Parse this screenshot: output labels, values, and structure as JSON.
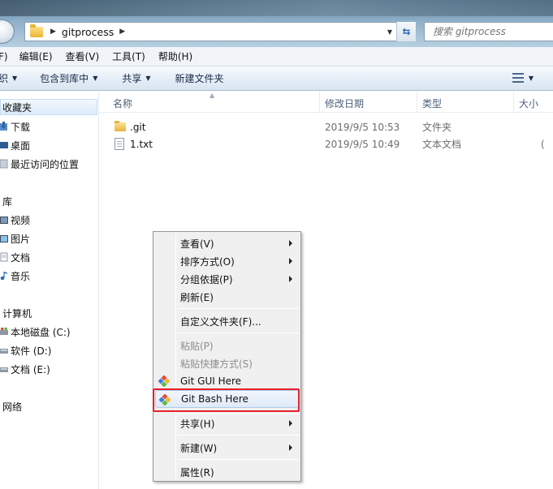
{
  "window": {
    "breadcrumb": [
      "gitprocess"
    ],
    "search_placeholder": "搜索 gitprocess"
  },
  "menubar": {
    "items": [
      "F)",
      "编辑(E)",
      "查看(V)",
      "工具(T)",
      "帮助(H)"
    ]
  },
  "commandbar": {
    "organize": "织",
    "include_in_library": "包含到库中",
    "share": "共享",
    "new_folder": "新建文件夹"
  },
  "navigation": {
    "favorites": {
      "label": "收藏夹",
      "items": [
        "下载",
        "桌面",
        "最近访问的位置"
      ]
    },
    "libraries": {
      "label": "库",
      "items": [
        "视频",
        "图片",
        "文档",
        "音乐"
      ]
    },
    "computer": {
      "label": "计算机",
      "items": [
        "本地磁盘 (C:)",
        "软件 (D:)",
        "文档 (E:)"
      ]
    },
    "network": {
      "label": "网络"
    }
  },
  "filelist": {
    "columns": {
      "name": "名称",
      "date": "修改日期",
      "type": "类型",
      "size": "大小"
    },
    "rows": [
      {
        "name": ".git",
        "date": "2019/9/5 10:53",
        "type": "文件夹",
        "size": "",
        "icon": "folder-icon"
      },
      {
        "name": "1.txt",
        "date": "2019/9/5 10:49",
        "type": "文本文档",
        "size": "(",
        "icon": "text-file-icon"
      }
    ]
  },
  "context_menu": {
    "items": [
      {
        "label": "查看(V)",
        "submenu": true,
        "disabled": false
      },
      {
        "label": "排序方式(O)",
        "submenu": true,
        "disabled": false
      },
      {
        "label": "分组依据(P)",
        "submenu": true,
        "disabled": false
      },
      {
        "label": "刷新(E)",
        "submenu": false,
        "disabled": false
      },
      {
        "label": "自定义文件夹(F)...",
        "submenu": false,
        "disabled": false
      },
      {
        "label": "粘贴(P)",
        "submenu": false,
        "disabled": true
      },
      {
        "label": "粘贴快捷方式(S)",
        "submenu": false,
        "disabled": true
      },
      {
        "label": "Git GUI Here",
        "submenu": false,
        "disabled": false,
        "icon": "git-gui-icon"
      },
      {
        "label": "Git Bash Here",
        "submenu": false,
        "disabled": false,
        "icon": "git-bash-icon",
        "highlighted": true
      },
      {
        "label": "共享(H)",
        "submenu": true,
        "disabled": false
      },
      {
        "label": "新建(W)",
        "submenu": true,
        "disabled": false
      },
      {
        "label": "属性(R)",
        "submenu": false,
        "disabled": false
      }
    ],
    "highlight_color": "#e5202c"
  },
  "colors": {
    "accent_blue": "#2a6ab7",
    "git_red": "#e64d35",
    "git_green": "#5db947",
    "git_blue": "#3a7ed9",
    "git_yellow": "#f2b52c"
  }
}
